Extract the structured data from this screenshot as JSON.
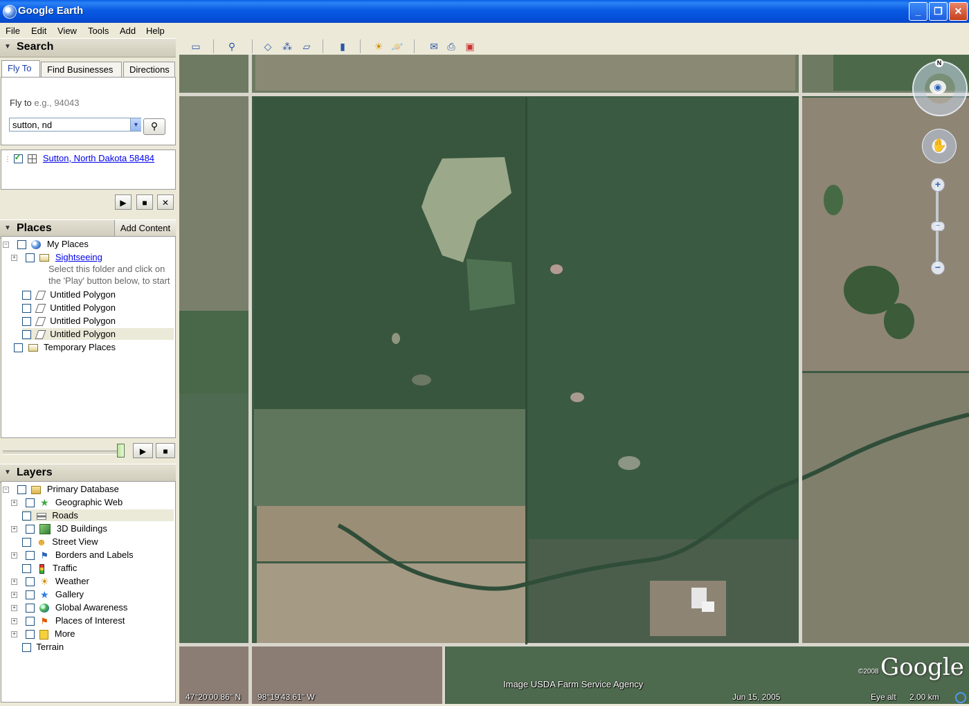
{
  "window": {
    "title": "Google Earth"
  },
  "menu": [
    "File",
    "Edit",
    "View",
    "Tools",
    "Add",
    "Help"
  ],
  "search": {
    "header": "Search",
    "tabs": [
      "Fly To",
      "Find Businesses",
      "Directions"
    ],
    "flyto_label": "Fly to",
    "flyto_hint": "e.g., 94043",
    "query": "sutton, nd",
    "result": "Sutton, North Dakota 58484"
  },
  "places": {
    "header": "Places",
    "add_content": "Add Content",
    "my_places": "My Places",
    "sightseeing": "Sightseeing",
    "sightseeing_note_1": "Select this folder and click on",
    "sightseeing_note_2": "the 'Play' button below, to start",
    "polygons": [
      "Untitled Polygon",
      "Untitled Polygon",
      "Untitled Polygon",
      "Untitled Polygon"
    ],
    "temporary": "Temporary Places"
  },
  "layers": {
    "header": "Layers",
    "primary": "Primary Database",
    "items": [
      "Geographic Web",
      "Roads",
      "3D Buildings",
      "Street View",
      "Borders and Labels",
      "Traffic",
      "Weather",
      "Gallery",
      "Global Awareness",
      "Places of Interest",
      "More"
    ],
    "terrain": "Terrain"
  },
  "map": {
    "credit": "Image USDA Farm Service Agency",
    "lat": "47°20'00.86\" N",
    "lon": "98°19'43.61\" W",
    "date": "Jun 15, 2005",
    "eye_label": "Eye alt",
    "eye_value": "2.00 km",
    "logo": "Google",
    "copyright": "©2008",
    "compass_n": "N"
  },
  "colors": {
    "titlebar": "#0a5ae3",
    "panel": "#ece9d8",
    "link": "#0000ee"
  }
}
